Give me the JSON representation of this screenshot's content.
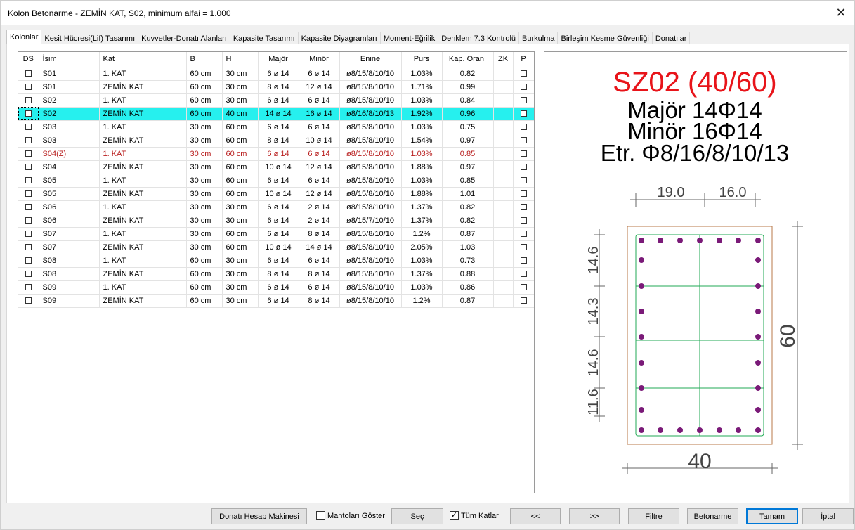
{
  "window": {
    "title": "Kolon Betonarme - ZEMİN KAT, S02, minimum alfai = 1.000",
    "close_glyph": "✕"
  },
  "tabs": [
    {
      "label": "Kolonlar",
      "active": true
    },
    {
      "label": "Kesit Hücresi(Lif) Tasarımı"
    },
    {
      "label": "Kuvvetler-Donatı Alanları"
    },
    {
      "label": "Kapasite Tasarımı"
    },
    {
      "label": "Kapasite Diyagramları"
    },
    {
      "label": "Moment-Eğrilik"
    },
    {
      "label": "Denklem 7.3 Kontrolü"
    },
    {
      "label": "Burkulma"
    },
    {
      "label": "Birleşim Kesme Güvenliği"
    },
    {
      "label": "Donatılar"
    }
  ],
  "table": {
    "columns": [
      "DS",
      "İsim",
      "Kat",
      "B",
      "H",
      "Majör",
      "Minör",
      "Enine",
      "Purs",
      "Kap. Oranı",
      "ZK",
      "P"
    ],
    "rows": [
      {
        "isim": "S01",
        "kat": "1. KAT",
        "b": "60 cm",
        "h": "30 cm",
        "major": "6 ø 14",
        "minor": "6 ø 14",
        "enine": "ø8/15/8/10/10",
        "purs": "1.03%",
        "kap": "0.82"
      },
      {
        "isim": "S01",
        "kat": "ZEMİN KAT",
        "b": "60 cm",
        "h": "30 cm",
        "major": "8 ø 14",
        "minor": "12 ø 14",
        "enine": "ø8/15/8/10/10",
        "purs": "1.71%",
        "kap": "0.99"
      },
      {
        "isim": "S02",
        "kat": "1. KAT",
        "b": "60 cm",
        "h": "30 cm",
        "major": "6 ø 14",
        "minor": "6 ø 14",
        "enine": "ø8/15/8/10/10",
        "purs": "1.03%",
        "kap": "0.84"
      },
      {
        "isim": "S02",
        "kat": "ZEMİN KAT",
        "b": "60 cm",
        "h": "40 cm",
        "major": "14 ø 14",
        "minor": "16 ø 14",
        "enine": "ø8/16/8/10/13",
        "purs": "1.92%",
        "kap": "0.96",
        "selected": true
      },
      {
        "isim": "S03",
        "kat": "1. KAT",
        "b": "30 cm",
        "h": "60 cm",
        "major": "6 ø 14",
        "minor": "6 ø 14",
        "enine": "ø8/15/8/10/10",
        "purs": "1.03%",
        "kap": "0.75"
      },
      {
        "isim": "S03",
        "kat": "ZEMİN KAT",
        "b": "30 cm",
        "h": "60 cm",
        "major": "8 ø 14",
        "minor": "10 ø 14",
        "enine": "ø8/15/8/10/10",
        "purs": "1.54%",
        "kap": "0.97"
      },
      {
        "isim": "S04(Z)",
        "kat": "1. KAT",
        "b": "30 cm",
        "h": "60 cm",
        "major": "6 ø 14",
        "minor": "6 ø 14",
        "enine": "ø8/15/8/10/10",
        "purs": "1.03%",
        "kap": "0.85",
        "warn": true
      },
      {
        "isim": "S04",
        "kat": "ZEMİN KAT",
        "b": "30 cm",
        "h": "60 cm",
        "major": "10 ø 14",
        "minor": "12 ø 14",
        "enine": "ø8/15/8/10/10",
        "purs": "1.88%",
        "kap": "0.97"
      },
      {
        "isim": "S05",
        "kat": "1. KAT",
        "b": "30 cm",
        "h": "60 cm",
        "major": "6 ø 14",
        "minor": "6 ø 14",
        "enine": "ø8/15/8/10/10",
        "purs": "1.03%",
        "kap": "0.85"
      },
      {
        "isim": "S05",
        "kat": "ZEMİN KAT",
        "b": "30 cm",
        "h": "60 cm",
        "major": "10 ø 14",
        "minor": "12 ø 14",
        "enine": "ø8/15/8/10/10",
        "purs": "1.88%",
        "kap": "1.01"
      },
      {
        "isim": "S06",
        "kat": "1. KAT",
        "b": "30 cm",
        "h": "30 cm",
        "major": "6 ø 14",
        "minor": "2 ø 14",
        "enine": "ø8/15/8/10/10",
        "purs": "1.37%",
        "kap": "0.82"
      },
      {
        "isim": "S06",
        "kat": "ZEMİN KAT",
        "b": "30 cm",
        "h": "30 cm",
        "major": "6 ø 14",
        "minor": "2 ø 14",
        "enine": "ø8/15/7/10/10",
        "purs": "1.37%",
        "kap": "0.82"
      },
      {
        "isim": "S07",
        "kat": "1. KAT",
        "b": "30 cm",
        "h": "60 cm",
        "major": "6 ø 14",
        "minor": "8 ø 14",
        "enine": "ø8/15/8/10/10",
        "purs": "1.2%",
        "kap": "0.87"
      },
      {
        "isim": "S07",
        "kat": "ZEMİN KAT",
        "b": "30 cm",
        "h": "60 cm",
        "major": "10 ø 14",
        "minor": "14 ø 14",
        "enine": "ø8/15/8/10/10",
        "purs": "2.05%",
        "kap": "1.03"
      },
      {
        "isim": "S08",
        "kat": "1. KAT",
        "b": "60 cm",
        "h": "30 cm",
        "major": "6 ø 14",
        "minor": "6 ø 14",
        "enine": "ø8/15/8/10/10",
        "purs": "1.03%",
        "kap": "0.73"
      },
      {
        "isim": "S08",
        "kat": "ZEMİN KAT",
        "b": "60 cm",
        "h": "30 cm",
        "major": "8 ø 14",
        "minor": "8 ø 14",
        "enine": "ø8/15/8/10/10",
        "purs": "1.37%",
        "kap": "0.88"
      },
      {
        "isim": "S09",
        "kat": "1. KAT",
        "b": "60 cm",
        "h": "30 cm",
        "major": "6 ø 14",
        "minor": "6 ø 14",
        "enine": "ø8/15/8/10/10",
        "purs": "1.03%",
        "kap": "0.86"
      },
      {
        "isim": "S09",
        "kat": "ZEMİN KAT",
        "b": "60 cm",
        "h": "30 cm",
        "major": "6 ø 14",
        "minor": "8 ø 14",
        "enine": "ø8/15/8/10/10",
        "purs": "1.2%",
        "kap": "0.87"
      }
    ]
  },
  "preview": {
    "title": "SZ02 (40/60)",
    "major": "Majör 14Φ14",
    "minor": "Minör 16Φ14",
    "stirrup": "Etr. Φ8/16/8/10/13",
    "dim_top_left": "19.0",
    "dim_top_right": "16.0",
    "dim_left": [
      "14.6",
      "14.3",
      "14.6",
      "11.6"
    ],
    "dim_right": "60",
    "dim_bottom": "40",
    "colors": {
      "title": "#e8141a",
      "concrete": "#b87a4a",
      "tie": "#22aa55",
      "rebar": "#7a1a78",
      "dim": "#555555"
    }
  },
  "bottom_bar": {
    "calculator": "Donatı Hesap Makinesi",
    "show_jackets": {
      "label": "Mantoları Göster",
      "checked": false
    },
    "select": "Seç",
    "all_floors": {
      "label": "Tüm Katlar",
      "checked": true
    },
    "prev": "<<",
    "next": ">>",
    "filter": "Filtre",
    "concrete": "Betonarme",
    "ok": "Tamam",
    "cancel": "İptal"
  }
}
